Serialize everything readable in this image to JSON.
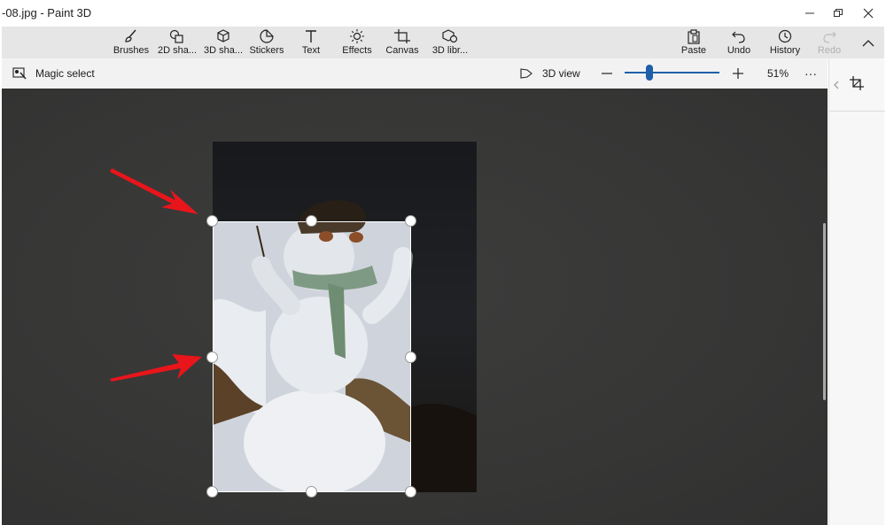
{
  "window": {
    "title": "-08.jpg - Paint 3D"
  },
  "ribbon": {
    "tools": [
      {
        "label": "Brushes",
        "icon": "brush-icon"
      },
      {
        "label": "2D sha...",
        "icon": "2d-shapes-icon"
      },
      {
        "label": "3D sha...",
        "icon": "3d-shapes-icon"
      },
      {
        "label": "Stickers",
        "icon": "stickers-icon"
      },
      {
        "label": "Text",
        "icon": "text-icon"
      },
      {
        "label": "Effects",
        "icon": "effects-icon"
      },
      {
        "label": "Canvas",
        "icon": "canvas-icon"
      },
      {
        "label": "3D libr...",
        "icon": "3d-library-icon"
      }
    ],
    "actions": [
      {
        "label": "Paste",
        "icon": "paste-icon"
      },
      {
        "label": "Undo",
        "icon": "undo-icon"
      },
      {
        "label": "History",
        "icon": "history-icon"
      },
      {
        "label": "Redo",
        "icon": "redo-icon",
        "disabled": true
      }
    ]
  },
  "toolbar": {
    "magic_select": "Magic select",
    "view_3d": "3D view",
    "zoom_percent": "51%",
    "zoom_level": 0.51,
    "more": "···"
  },
  "colors": {
    "accent": "#1f5fa8",
    "canvas_bg": "#363635",
    "annotation_arrow": "#e8151b"
  }
}
